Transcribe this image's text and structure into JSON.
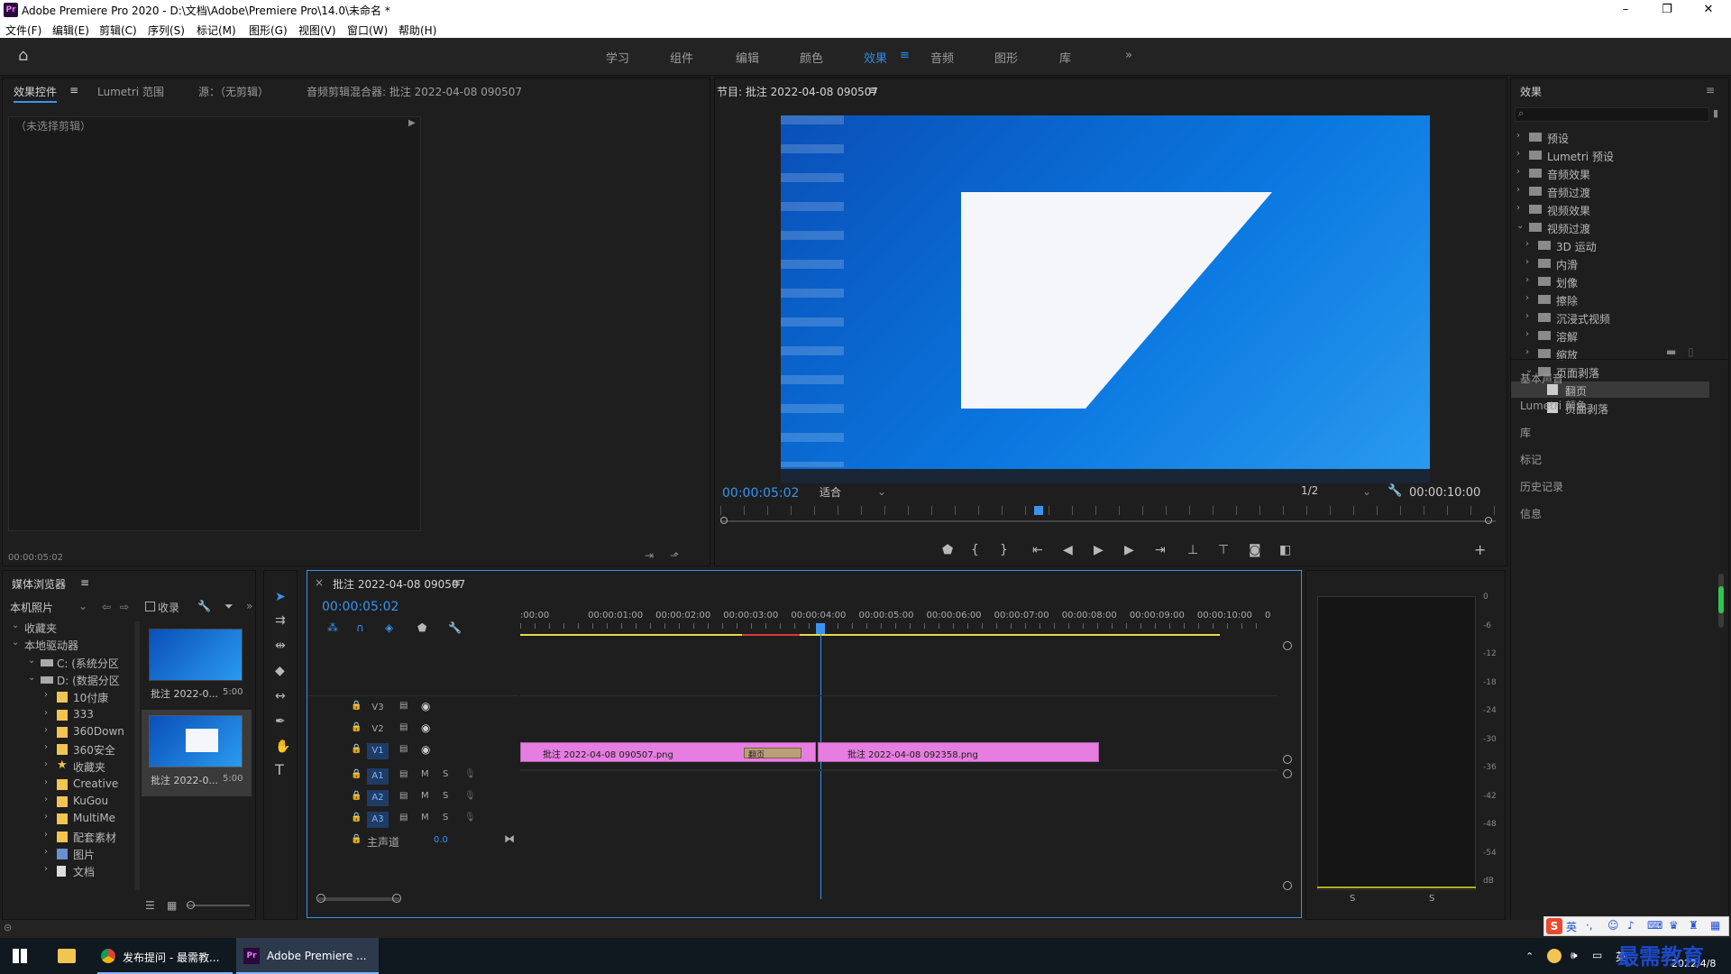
{
  "app": {
    "icon_text": "Pr",
    "title": "Adobe Premiere Pro 2020 - D:\\文档\\Adobe\\Premiere Pro\\14.0\\未命名 *"
  },
  "menu": [
    "文件(F)",
    "编辑(E)",
    "剪辑(C)",
    "序列(S)",
    "标记(M)",
    "图形(G)",
    "视图(V)",
    "窗口(W)",
    "帮助(H)"
  ],
  "workspaces": [
    "学习",
    "组件",
    "编辑",
    "颜色",
    "效果",
    "音频",
    "图形",
    "库"
  ],
  "active_workspace": "效果",
  "source_panel": {
    "tabs": [
      "效果控件",
      "Lumetri 范围",
      "源：（无剪辑）",
      "音频剪辑混合器: 批注 2022-04-08 090507"
    ],
    "no_clip": "（未选择剪辑）",
    "timecode": "00:00:05:02"
  },
  "program": {
    "title": "节目: 批注 2022-04-08 090507",
    "timecode": "00:00:05:02",
    "fit": "适合",
    "resolution": "1/2",
    "duration": "00:00:10:00",
    "playhead_fraction": 0.5
  },
  "effects": {
    "title": "效果",
    "items": [
      {
        "label": "预设",
        "level": 0,
        "open": false
      },
      {
        "label": "Lumetri 预设",
        "level": 0,
        "open": false
      },
      {
        "label": "音频效果",
        "level": 0,
        "open": false
      },
      {
        "label": "音频过渡",
        "level": 0,
        "open": false
      },
      {
        "label": "视频效果",
        "level": 0,
        "open": false
      },
      {
        "label": "视频过渡",
        "level": 0,
        "open": true
      },
      {
        "label": "3D 运动",
        "level": 1,
        "open": false
      },
      {
        "label": "内滑",
        "level": 1,
        "open": false
      },
      {
        "label": "划像",
        "level": 1,
        "open": false
      },
      {
        "label": "擦除",
        "level": 1,
        "open": false
      },
      {
        "label": "沉浸式视频",
        "level": 1,
        "open": false
      },
      {
        "label": "溶解",
        "level": 1,
        "open": false
      },
      {
        "label": "缩放",
        "level": 1,
        "open": false
      },
      {
        "label": "页面剥落",
        "level": 1,
        "open": true
      },
      {
        "label": "翻页",
        "level": 2,
        "open": false,
        "selected": true
      },
      {
        "label": "页面剥落",
        "level": 2,
        "open": false
      }
    ],
    "sections": [
      "基本声音",
      "Lumetri 颜色",
      "库",
      "标记",
      "历史记录",
      "信息"
    ]
  },
  "media_browser": {
    "title": "媒体浏览器",
    "location": "本机照片",
    "ingest": "收录",
    "tree": [
      {
        "label": "收藏夹",
        "level": 0
      },
      {
        "label": "本地驱动器",
        "level": 0
      },
      {
        "label": "C: (系统分区",
        "level": 1,
        "type": "drive"
      },
      {
        "label": "D: (数据分区",
        "level": 1,
        "type": "drive"
      },
      {
        "label": "10付康",
        "level": 2,
        "type": "folder"
      },
      {
        "label": "333",
        "level": 2,
        "type": "folder"
      },
      {
        "label": "360Down",
        "level": 2,
        "type": "folder"
      },
      {
        "label": "360安全",
        "level": 2,
        "type": "folder"
      },
      {
        "label": "收藏夹",
        "level": 2,
        "type": "star"
      },
      {
        "label": "Creative",
        "level": 2,
        "type": "folder"
      },
      {
        "label": "KuGou",
        "level": 2,
        "type": "folder"
      },
      {
        "label": "MultiMe",
        "level": 2,
        "type": "folder"
      },
      {
        "label": "配套素材",
        "level": 2,
        "type": "folder"
      },
      {
        "label": "图片",
        "level": 2,
        "type": "pic"
      },
      {
        "label": "文档",
        "level": 2,
        "type": "doc"
      }
    ],
    "thumbs": [
      {
        "name": "批注 2022-0...",
        "duration": "5:00"
      },
      {
        "name": "批注 2022-0...",
        "duration": "5:00"
      }
    ]
  },
  "timeline": {
    "sequence": "批注 2022-04-08 090507",
    "timecode": "00:00:05:02",
    "ruler": [
      ":00:00",
      "00:00:01:00",
      "00:00:02:00",
      "00:00:03:00",
      "00:00:04:00",
      "00:00:05:00",
      "00:00:06:00",
      "00:00:07:00",
      "00:00:08:00",
      "00:00:09:00",
      "00:00:10:00",
      "0"
    ],
    "video_tracks": [
      "V3",
      "V2",
      "V1"
    ],
    "audio_tracks": [
      "A1",
      "A2",
      "A3"
    ],
    "master": "主声道",
    "master_value": "0.0",
    "clips": [
      {
        "name": "批注 2022-04-08 090507.png"
      },
      {
        "name": "批注 2022-04-08 092358.png"
      }
    ],
    "transition": "翻页"
  },
  "audio_meter": {
    "scale": [
      "0",
      "-6",
      "-12",
      "-18",
      "-24",
      "-30",
      "-36",
      "-42",
      "-48",
      "-54",
      "dB"
    ],
    "solo": [
      "S",
      "S"
    ]
  },
  "taskbar": {
    "items": [
      {
        "label": "发布提问 - 最需教..."
      },
      {
        "label": "Adobe Premiere ..."
      }
    ],
    "ime": "英",
    "date": "2022/4/8",
    "watermark": "最需教育"
  }
}
